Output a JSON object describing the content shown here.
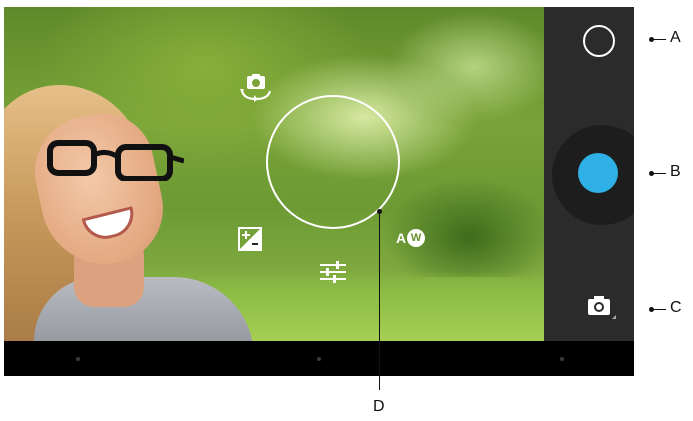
{
  "viewfinder": {
    "focus_ring": "focus-ring",
    "auto_white_balance": {
      "prefix": "A",
      "badge": "W"
    }
  },
  "icons": {
    "switch_camera": "switch-camera-icon",
    "exposure": "exposure-icon",
    "settings": "settings-sliders-icon"
  },
  "right_panel": {
    "mode_button": "mode-circle",
    "shutter_color": "#2fb0e6",
    "camera_mode_icon": "camera-icon"
  },
  "callouts": {
    "a": "A",
    "b": "B",
    "c": "C",
    "d": "D"
  }
}
